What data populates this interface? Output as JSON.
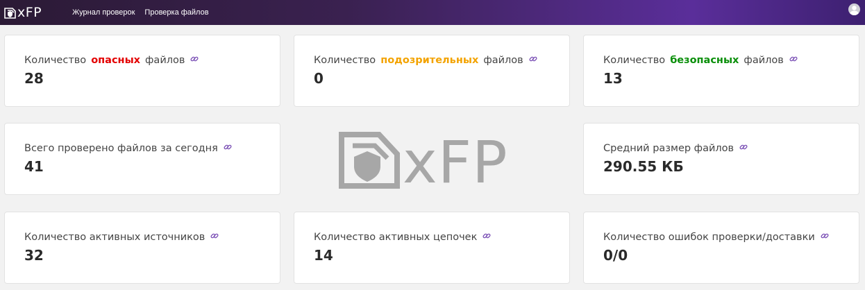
{
  "header": {
    "logo_text": "xFP",
    "nav": [
      "Журнал проверок",
      "Проверка файлов"
    ]
  },
  "cards": {
    "dangerous": {
      "prefix": "Количество",
      "highlight": "опасных",
      "suffix": "файлов",
      "value": "28"
    },
    "suspicious": {
      "prefix": "Количество",
      "highlight": "подозрительных",
      "suffix": "файлов",
      "value": "0"
    },
    "safe": {
      "prefix": "Количество",
      "highlight": "безопасных",
      "suffix": "файлов",
      "value": "13"
    },
    "checked_today": {
      "label": "Всего проверено файлов за сегодня",
      "value": "41"
    },
    "avg_size": {
      "label": "Средний размер файлов",
      "value": "290.55 КБ"
    },
    "active_sources": {
      "label": "Количество активных источников",
      "value": "32"
    },
    "active_chains": {
      "label": "Количество активных цепочек",
      "value": "14"
    },
    "errors": {
      "label": "Количество ошибок проверки/доставки",
      "value": "0/0"
    }
  },
  "watermark": {
    "text": "xFP"
  },
  "colors": {
    "danger": "#e30000",
    "warning": "#f3a300",
    "safe": "#0a8f0a",
    "link_icon": "#7a4fb5",
    "header_gradient_end": "#5a2e9a"
  },
  "icons": [
    "xfp-logo-icon",
    "link-icon",
    "user-avatar-icon"
  ]
}
